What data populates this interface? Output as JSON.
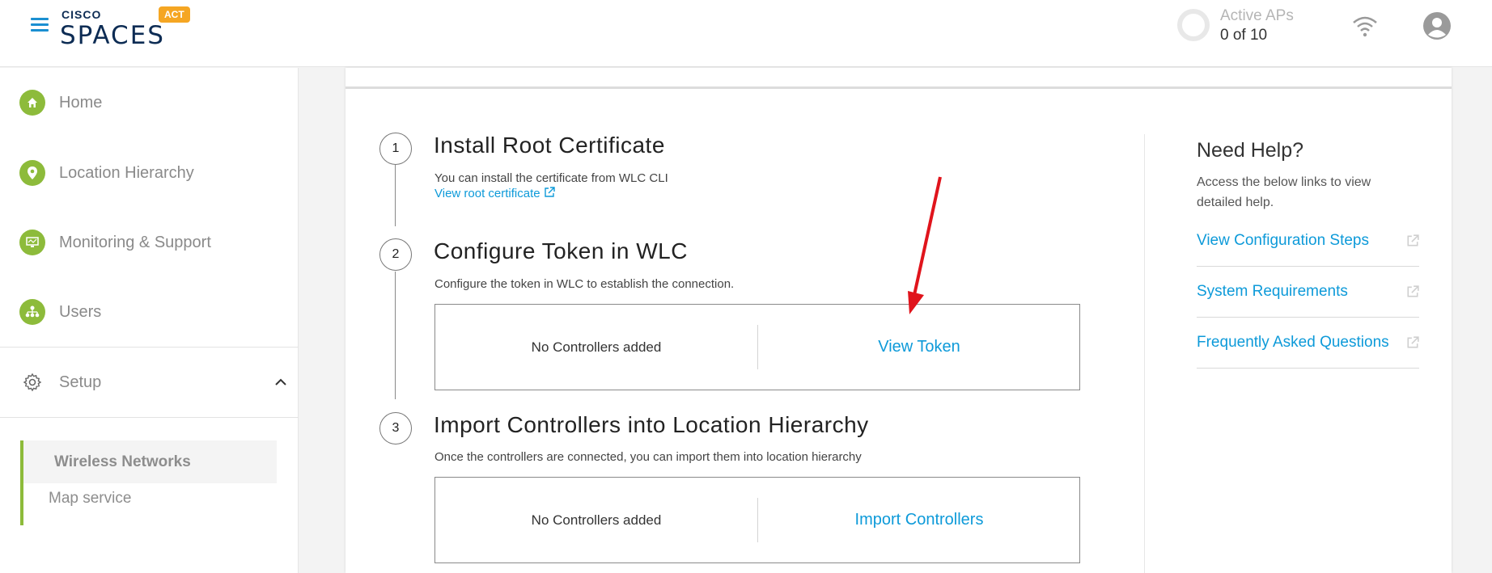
{
  "header": {
    "brand_top": "CISCO",
    "brand_main": "SPACES",
    "badge": "ACT",
    "active_aps_label": "Active APs",
    "active_aps_value": "0 of 10",
    "active_aps_fraction": 0
  },
  "sidebar": {
    "items": [
      {
        "label": "Home",
        "icon": "home-icon"
      },
      {
        "label": "Location Hierarchy",
        "icon": "location-pin-icon"
      },
      {
        "label": "Monitoring & Support",
        "icon": "monitor-icon"
      },
      {
        "label": "Users",
        "icon": "users-hierarchy-icon"
      }
    ],
    "setup": {
      "label": "Setup",
      "expanded": true
    },
    "sub_items": [
      {
        "label": "Wireless Networks",
        "active": true
      },
      {
        "label": "Map service",
        "active": false
      }
    ]
  },
  "steps": [
    {
      "number": "1",
      "title": "Install Root Certificate",
      "description": "You can install the certificate from WLC CLI",
      "link": "View root certificate"
    },
    {
      "number": "2",
      "title": "Configure Token in WLC",
      "description": "Configure the token in WLC to establish the connection.",
      "empty_text": "No Controllers added",
      "action": "View Token"
    },
    {
      "number": "3",
      "title": "Import Controllers into Location Hierarchy",
      "description": "Once the controllers are connected, you can import them into location hierarchy",
      "empty_text": "No Controllers added",
      "action": "Import Controllers"
    }
  ],
  "help": {
    "title": "Need Help?",
    "description": "Access the below links to view detailed help.",
    "links": [
      "View Configuration Steps",
      "System Requirements",
      "Frequently Asked Questions"
    ]
  },
  "colors": {
    "accent": "#0d9ad9",
    "nav_green": "#8dbb3b",
    "badge": "#f5a623",
    "annotation_arrow": "#e0141c"
  }
}
